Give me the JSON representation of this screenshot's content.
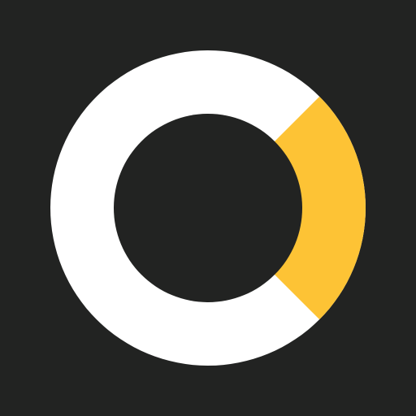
{
  "icon": {
    "name": "ring-logo-icon",
    "colors": {
      "background": "#222322",
      "ring": "#FFFFFF",
      "accent": "#FDC335",
      "hole": "#222322"
    },
    "accent_fraction": 0.25
  }
}
